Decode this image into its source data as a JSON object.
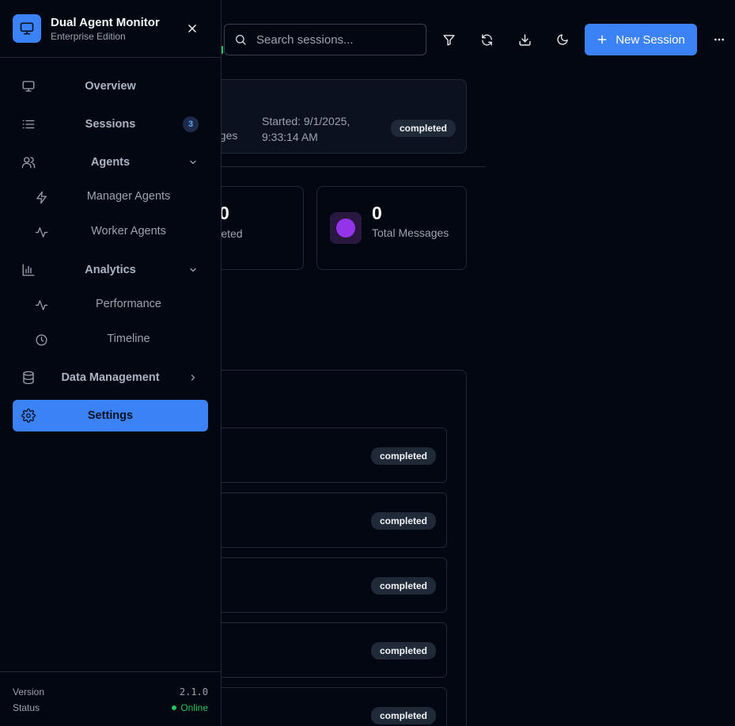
{
  "header": {
    "search_placeholder": "Search sessions...",
    "new_session_label": "New Session"
  },
  "session_card": {
    "messages_fragment": "sages",
    "started_label": "Started: 9/1/2025,",
    "started_time": "9:33:14 AM",
    "status": "completed"
  },
  "stats": [
    {
      "value": "0",
      "label": "ompleted"
    },
    {
      "value": "0",
      "label": "Total Messages"
    }
  ],
  "session_rows": [
    {
      "status": "completed"
    },
    {
      "status": "completed"
    },
    {
      "status": "completed"
    },
    {
      "status": "completed"
    },
    {
      "status": "completed"
    }
  ],
  "sidebar": {
    "title": "Dual Agent Monitor",
    "subtitle": "Enterprise Edition",
    "items": {
      "overview": "Overview",
      "sessions": "Sessions",
      "sessions_count": "3",
      "agents": "Agents",
      "manager_agents": "Manager Agents",
      "worker_agents": "Worker Agents",
      "analytics": "Analytics",
      "performance": "Performance",
      "timeline": "Timeline",
      "data_management": "Data Management",
      "settings": "Settings"
    },
    "footer": {
      "version_label": "Version",
      "version_value": "2.1.0",
      "status_label": "Status",
      "status_value": "Online"
    }
  },
  "colors": {
    "accent": "#3b82f6",
    "background": "#030712",
    "online": "#22c55e",
    "stat_icon": "#9333ea"
  }
}
